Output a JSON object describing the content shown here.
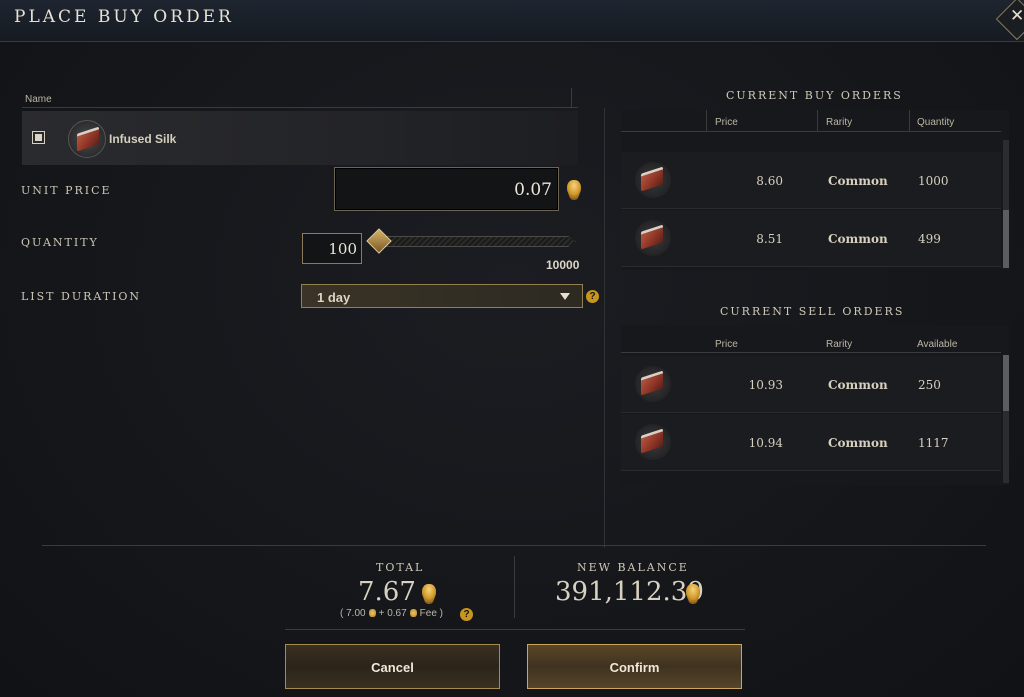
{
  "window": {
    "title": "PLACE BUY ORDER"
  },
  "item_table": {
    "header_name": "Name"
  },
  "item": {
    "name": "Infused Silk",
    "icon": "silk-bolt-icon"
  },
  "form": {
    "unit_price_label": "UNIT PRICE",
    "unit_price_value": "0.07",
    "quantity_label": "QUANTITY",
    "quantity_value": "100",
    "quantity_max": "10000",
    "duration_label": "LIST DURATION",
    "duration_value": "1 day",
    "help_glyph": "?"
  },
  "buy_orders": {
    "title": "CURRENT BUY ORDERS",
    "columns": [
      "Price",
      "Rarity",
      "Quantity"
    ],
    "rows": [
      {
        "price": "8.60",
        "rarity": "Common",
        "quantity": "1000"
      },
      {
        "price": "8.51",
        "rarity": "Common",
        "quantity": "499"
      }
    ]
  },
  "sell_orders": {
    "title": "CURRENT SELL ORDERS",
    "columns": [
      "Price",
      "Rarity",
      "Available"
    ],
    "rows": [
      {
        "price": "10.93",
        "rarity": "Common",
        "quantity": "250"
      },
      {
        "price": "10.94",
        "rarity": "Common",
        "quantity": "1117"
      }
    ]
  },
  "summary": {
    "total_label": "TOTAL",
    "total_value": "7.67",
    "fee_open": "( 7.00",
    "fee_plus": "+ 0.67",
    "fee_close": "Fee )",
    "balance_label": "NEW BALANCE",
    "balance_value": "391,112.39"
  },
  "buttons": {
    "cancel": "Cancel",
    "confirm": "Confirm"
  },
  "colors": {
    "gold_accent": "#c9a55d",
    "background": "#15171b",
    "coin": "#d19a2d"
  }
}
